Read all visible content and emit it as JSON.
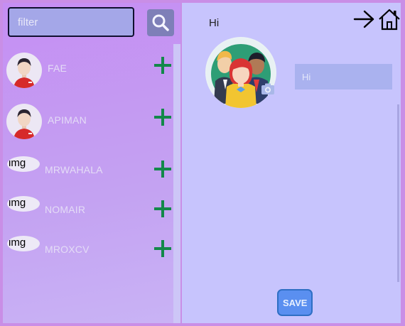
{
  "search": {
    "placeholder": "filter",
    "button_icon": "search-icon"
  },
  "users": [
    {
      "name": "FAE",
      "avatar": "photo",
      "add_icon": "plus-icon"
    },
    {
      "name": "APIMAN",
      "avatar": "photo",
      "add_icon": "plus-icon"
    },
    {
      "name": "MRWAHALA",
      "avatar": "broken",
      "alt": "img",
      "add_icon": "plus-icon"
    },
    {
      "name": "NOMAIR",
      "avatar": "broken",
      "alt": "img",
      "add_icon": "plus-icon"
    },
    {
      "name": "MROXCV",
      "avatar": "broken",
      "alt": "img",
      "add_icon": "plus-icon"
    }
  ],
  "profile": {
    "greeting": "Hi",
    "name_value": "Hi",
    "save_label": "SAVE",
    "picture": "group-avatar",
    "camera_icon": "camera-icon"
  },
  "header_icons": {
    "exit": "arrow-right-icon",
    "home": "home-icon"
  },
  "colors": {
    "left_bg": "#c58ef3",
    "right_bg": "#c7c4fd",
    "add_green": "#13884a",
    "save_blue": "#5a8ff0"
  }
}
